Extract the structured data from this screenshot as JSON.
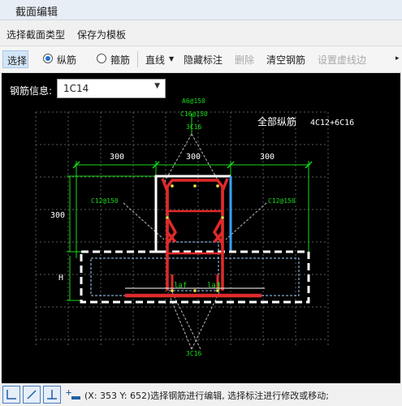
{
  "window": {
    "title": "截面编辑"
  },
  "menu": {
    "select_type": "选择截面类型",
    "save_template": "保存为模板"
  },
  "toolbar": {
    "select": "选择",
    "longitudinal": "纵筋",
    "stirrup": "箍筋",
    "line": "直线",
    "hide_label": "隐藏标注",
    "delete": "删除",
    "clear_rebar": "清空钢筋",
    "set_dashed": "设置虚线边",
    "more": "▸"
  },
  "rebar_info": {
    "label": "钢筋信息:",
    "value": "1C14"
  },
  "drawing": {
    "top_label_1": "A6@150",
    "top_label_2": "C16@150",
    "top_label_3": "3C16",
    "all_long_label": "全部纵筋",
    "all_long_value": "4C12+6C16",
    "dim_left": "300",
    "dim_mid": "300",
    "dim_right": "300",
    "dim_vert": "300",
    "left_side_label": "C12@150",
    "right_side_label": "C12@150",
    "h_label": "H",
    "la_left": "laf",
    "la_right": "laf",
    "bottom_label": "3C16"
  },
  "status": {
    "text": "(X: 353 Y: 652)选择钢筋进行编辑, 选择标注进行修改或移动;"
  },
  "colors": {
    "rebar": "#e02a2a",
    "dim": "#19d919",
    "outline": "#ffffff",
    "dashed_box": "#bfe3ff",
    "accent": "#1f6fd1"
  }
}
